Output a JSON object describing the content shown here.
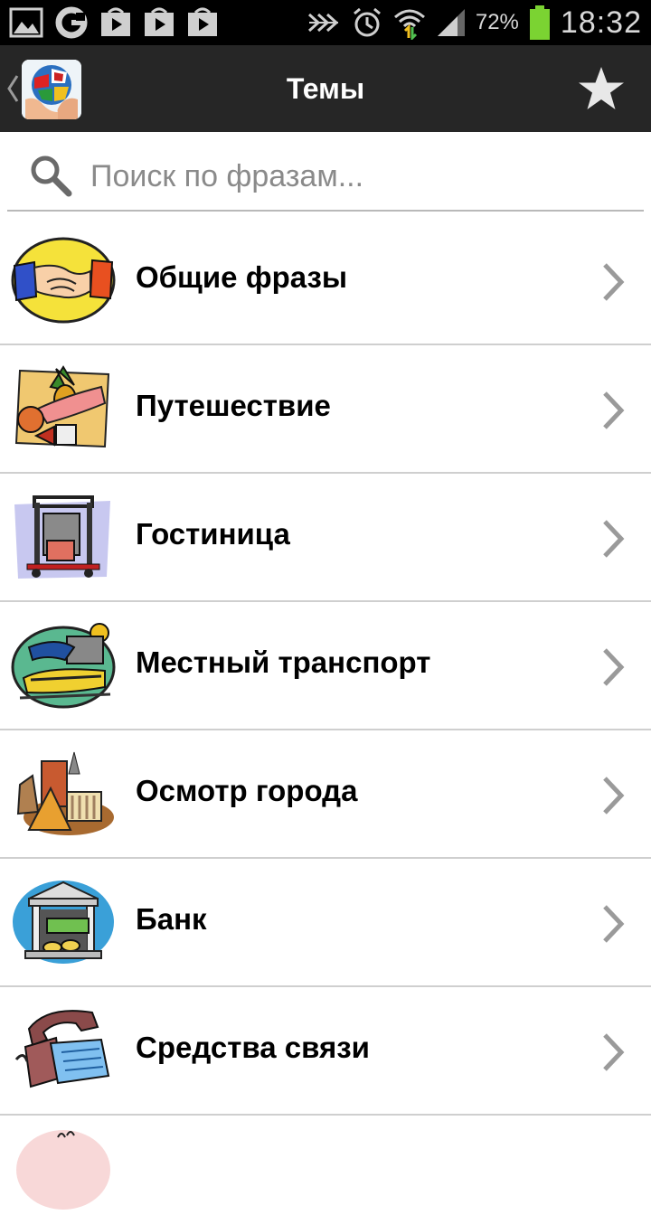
{
  "status_bar": {
    "battery_percent": "72%",
    "time": "18:32",
    "icons": [
      "gallery-icon",
      "google-icon",
      "play-store-icon",
      "play-store-icon",
      "play-store-icon",
      "nfc-icon",
      "alarm-icon",
      "wifi-icon",
      "signal-icon",
      "battery-icon"
    ]
  },
  "action_bar": {
    "title": "Темы",
    "icons": [
      "up-caret-icon",
      "app-logo-globe-icon",
      "star-icon"
    ]
  },
  "search": {
    "placeholder": "Поиск по фразам..."
  },
  "topics": [
    {
      "label": "Общие фразы",
      "icon": "handshake-icon"
    },
    {
      "label": "Путешествие",
      "icon": "travel-icon"
    },
    {
      "label": "Гостиница",
      "icon": "hotel-luggage-icon"
    },
    {
      "label": "Местный транспорт",
      "icon": "train-icon"
    },
    {
      "label": "Осмотр города",
      "icon": "landmarks-icon"
    },
    {
      "label": "Банк",
      "icon": "bank-icon"
    },
    {
      "label": "Средства связи",
      "icon": "telephone-icon"
    }
  ],
  "colors": {
    "status_bar_bg": "#000000",
    "action_bar_bg": "#262626",
    "divider": "#cfcfcf",
    "chevron": "#9a9a9a"
  }
}
